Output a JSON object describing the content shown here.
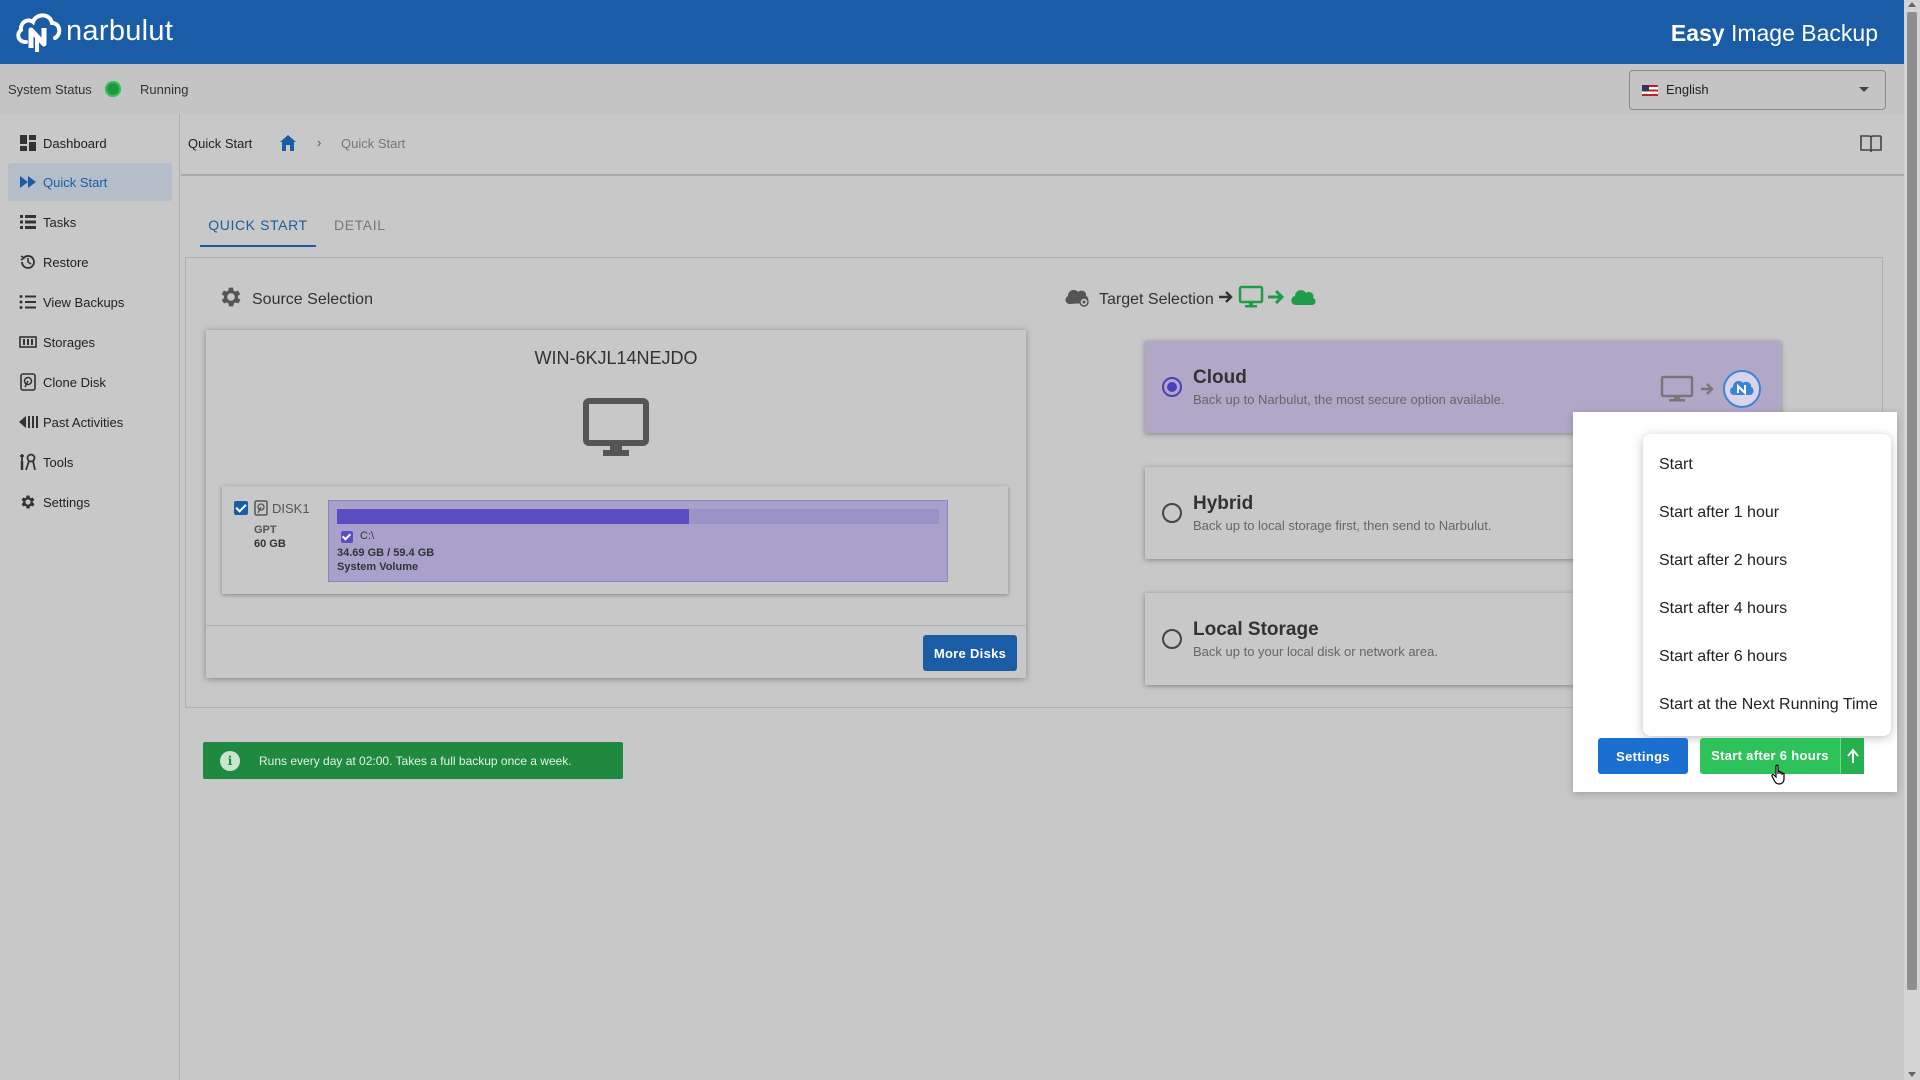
{
  "app": {
    "logo_text": "narbulut",
    "product_bold": "Easy",
    "product_rest": " Image Backup"
  },
  "status": {
    "label": "System Status",
    "value": "Running",
    "color": "#1a9a3a"
  },
  "language": {
    "selected": "English"
  },
  "sidebar": {
    "items": [
      {
        "label": "Dashboard",
        "icon": "dashboard-icon",
        "active": false
      },
      {
        "label": "Quick Start",
        "icon": "fast-forward-icon",
        "active": true
      },
      {
        "label": "Tasks",
        "icon": "list-icon",
        "active": false
      },
      {
        "label": "Restore",
        "icon": "history-icon",
        "active": false
      },
      {
        "label": "View Backups",
        "icon": "list-bullets-icon",
        "active": false
      },
      {
        "label": "Storages",
        "icon": "storage-icon",
        "active": false
      },
      {
        "label": "Clone Disk",
        "icon": "disk-icon",
        "active": false
      },
      {
        "label": "Past Activities",
        "icon": "rewind-icon",
        "active": false
      },
      {
        "label": "Tools",
        "icon": "tools-icon",
        "active": false
      },
      {
        "label": "Settings",
        "icon": "gear-icon",
        "active": false
      }
    ]
  },
  "breadcrumb": {
    "title": "Quick Start",
    "separator": "›",
    "current": "Quick Start"
  },
  "tabs": [
    {
      "label": "QUICK START",
      "active": true
    },
    {
      "label": "DETAIL",
      "active": false
    }
  ],
  "source": {
    "heading": "Source Selection",
    "computer": "WIN-6KJL14NEJDO",
    "disk": {
      "name": "DISK1",
      "type": "GPT",
      "size": "60 GB",
      "partition": {
        "letter": "C:\\",
        "usage": "34.69 GB / 59.4 GB",
        "label": "System Volume",
        "used_fraction": 0.584
      }
    },
    "more_disks_label": "More Disks"
  },
  "target": {
    "heading": "Target Selection",
    "options": [
      {
        "title": "Cloud",
        "desc": "Back up to Narbulut, the most secure option available.",
        "selected": true
      },
      {
        "title": "Hybrid",
        "desc": "Back up to local storage first, then send to Narbulut.",
        "selected": false
      },
      {
        "title": "Local Storage",
        "desc": "Back up to your local disk or network area.",
        "selected": false
      }
    ]
  },
  "schedule_info": "Runs every day at 02:00. Takes a full backup once a week.",
  "start_menu": {
    "items": [
      "Start",
      "Start after 1 hour",
      "Start after 2 hours",
      "Start after 4 hours",
      "Start after 6 hours",
      "Start at the Next Running Time"
    ]
  },
  "actions": {
    "settings_label": "Settings",
    "start_label": "Start after 6 hours"
  },
  "colors": {
    "brand": "#1a5da6",
    "accent_green": "#2ec35a",
    "selected_purple": "#4a3fb8"
  }
}
